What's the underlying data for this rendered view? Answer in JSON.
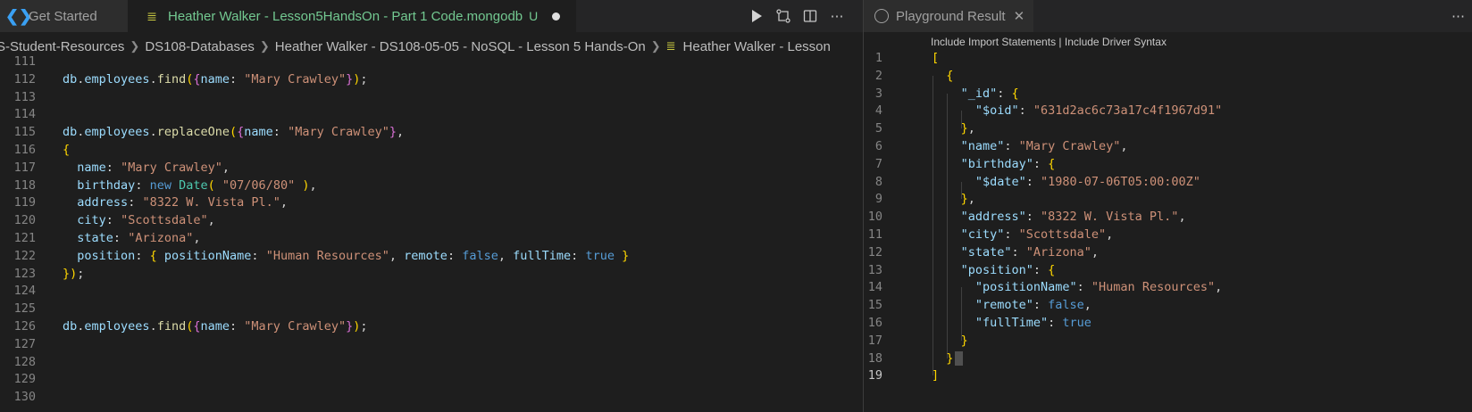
{
  "left_tabs": {
    "get_started": "Get Started",
    "active_file": "Heather Walker - Lesson5HandsOn - Part 1 Code.mongodb",
    "git_status": "U"
  },
  "editor_actions": [
    "run-icon",
    "compare-icon",
    "split-editor-icon",
    "more-actions-icon"
  ],
  "breadcrumb": [
    "S-Student-Resources",
    "DS108-Databases",
    "Heather Walker - DS108-05-05 - NoSQL - Lesson 5 Hands-On",
    "Heather Walker - Lesson"
  ],
  "code_lines": [
    {
      "n": "111",
      "text": ""
    },
    {
      "n": "112",
      "text": "db.employees.find({name: \"Mary Crawley\"});"
    },
    {
      "n": "113",
      "text": ""
    },
    {
      "n": "114",
      "text": ""
    },
    {
      "n": "115",
      "text": "db.employees.replaceOne({name: \"Mary Crawley\"},"
    },
    {
      "n": "116",
      "text": "{"
    },
    {
      "n": "117",
      "text": "  name: \"Mary Crawley\","
    },
    {
      "n": "118",
      "text": "  birthday: new Date( \"07/06/80\" ),"
    },
    {
      "n": "119",
      "text": "  address: \"8322 W. Vista Pl.\","
    },
    {
      "n": "120",
      "text": "  city: \"Scottsdale\","
    },
    {
      "n": "121",
      "text": "  state: \"Arizona\","
    },
    {
      "n": "122",
      "text": "  position: { positionName: \"Human Resources\", remote: false, fullTime: true }"
    },
    {
      "n": "123",
      "text": "});"
    },
    {
      "n": "124",
      "text": ""
    },
    {
      "n": "125",
      "text": ""
    },
    {
      "n": "126",
      "text": "db.employees.find({name: \"Mary Crawley\"});"
    },
    {
      "n": "127",
      "text": ""
    },
    {
      "n": "128",
      "text": ""
    },
    {
      "n": "129",
      "text": ""
    },
    {
      "n": "130",
      "text": ""
    }
  ],
  "result_tab": {
    "label": "Playground Result"
  },
  "codelens": {
    "include_import": "Include Import Statements",
    "separator": "|",
    "include_driver": "Include Driver Syntax"
  },
  "result_lines": [
    {
      "n": "1",
      "text": "["
    },
    {
      "n": "2",
      "text": "  {"
    },
    {
      "n": "3",
      "text": "    \"_id\": {"
    },
    {
      "n": "4",
      "text": "      \"$oid\": \"631d2ac6c73a17c4f1967d91\""
    },
    {
      "n": "5",
      "text": "    },"
    },
    {
      "n": "6",
      "text": "    \"name\": \"Mary Crawley\","
    },
    {
      "n": "7",
      "text": "    \"birthday\": {"
    },
    {
      "n": "8",
      "text": "      \"$date\": \"1980-07-06T05:00:00Z\""
    },
    {
      "n": "9",
      "text": "    },"
    },
    {
      "n": "10",
      "text": "    \"address\": \"8322 W. Vista Pl.\","
    },
    {
      "n": "11",
      "text": "    \"city\": \"Scottsdale\","
    },
    {
      "n": "12",
      "text": "    \"state\": \"Arizona\","
    },
    {
      "n": "13",
      "text": "    \"position\": {"
    },
    {
      "n": "14",
      "text": "      \"positionName\": \"Human Resources\","
    },
    {
      "n": "15",
      "text": "      \"remote\": false,"
    },
    {
      "n": "16",
      "text": "      \"fullTime\": true"
    },
    {
      "n": "17",
      "text": "    }"
    },
    {
      "n": "18",
      "text": "  }"
    },
    {
      "n": "19",
      "text": "]"
    }
  ]
}
